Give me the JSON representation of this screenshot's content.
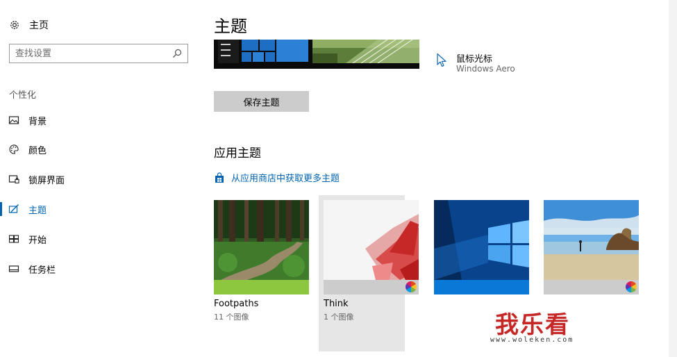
{
  "sidebar": {
    "home_label": "主页",
    "search_placeholder": "查找设置",
    "section_title": "个性化",
    "items": [
      {
        "label": "背景",
        "icon": "picture-icon"
      },
      {
        "label": "颜色",
        "icon": "palette-icon"
      },
      {
        "label": "锁屏界面",
        "icon": "lock-screen-icon"
      },
      {
        "label": "主题",
        "icon": "theme-brush-icon",
        "active": true
      },
      {
        "label": "开始",
        "icon": "start-grid-icon"
      },
      {
        "label": "任务栏",
        "icon": "taskbar-icon"
      }
    ]
  },
  "main": {
    "title": "主题",
    "cursor_label": "鼠标光标",
    "cursor_value": "Windows Aero",
    "save_button": "保存主题",
    "apply_title": "应用主题",
    "store_link": "从应用商店中获取更多主题",
    "themes": [
      {
        "name": "Footpaths",
        "count": "11 个图像",
        "strip_color": "#8dc63f",
        "multicolor": false
      },
      {
        "name": "Think",
        "count": "1 个图像",
        "strip_color": "#cccccc",
        "multicolor": true,
        "selected": true
      },
      {
        "name": "",
        "count": "",
        "strip_color": "#0a78d7",
        "multicolor": false
      },
      {
        "name": "",
        "count": "",
        "strip_color": "#cccccc",
        "multicolor": true
      }
    ]
  },
  "watermark": {
    "text": "我乐看",
    "url": "www.woleken.com"
  },
  "colors": {
    "accent": "#0063b1"
  }
}
